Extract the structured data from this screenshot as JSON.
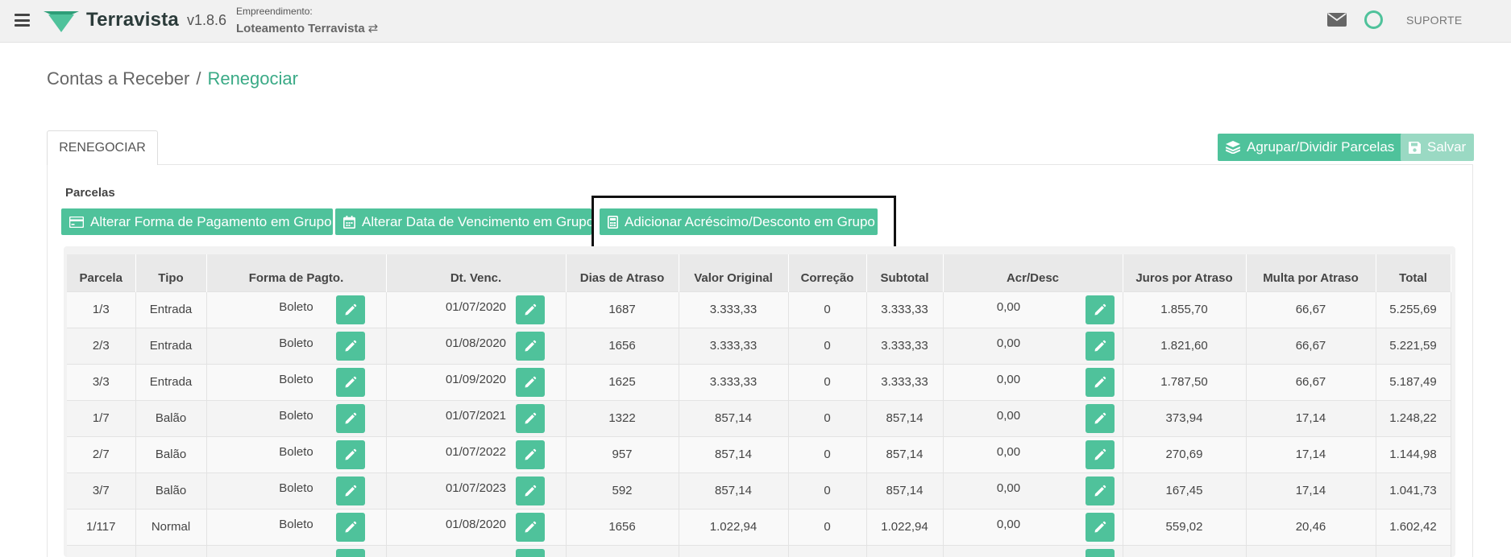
{
  "header": {
    "brand": "Terravista",
    "version": "v1.8.6",
    "empreendimento_label": "Empreendimento:",
    "empreendimento_value": "Loteamento Terravista",
    "swap_glyph": "⇄",
    "support_label": "SUPORTE",
    "brand_color": "#2b3b3a",
    "accent_color": "#4fc29b"
  },
  "breadcrumb": {
    "parent": "Contas a Receber",
    "separator": "/",
    "current": "Renegociar"
  },
  "tab": {
    "label": "RENEGOCIAR"
  },
  "actions": {
    "agrupar_label": "Agrupar/Dividir Parcelas",
    "salvar_label": "Salvar"
  },
  "parcelas": {
    "section_label": "Parcelas",
    "bulk_payment_label": "Alterar Forma de Pagamento em Grupo",
    "bulk_due_date_label": "Alterar Data de Vencimento em Grupo",
    "bulk_add_discount_label": "Adicionar Acréscimo/Desconto em Grupo"
  },
  "table": {
    "columns": [
      "Parcela",
      "Tipo",
      "Forma de Pagto.",
      "Dt. Venc.",
      "Dias de Atraso",
      "Valor Original",
      "Correção",
      "Subtotal",
      "Acr/Desc",
      "Juros por Atraso",
      "Multa por Atraso",
      "Total"
    ],
    "rows": [
      {
        "parcela": "1/3",
        "tipo": "Entrada",
        "forma": "Boleto",
        "venc": "01/07/2020",
        "dias": "1687",
        "valor": "3.333,33",
        "correcao": "0",
        "subtotal": "3.333,33",
        "acr": "0,00",
        "juros": "1.855,70",
        "multa": "66,67",
        "total": "5.255,69"
      },
      {
        "parcela": "2/3",
        "tipo": "Entrada",
        "forma": "Boleto",
        "venc": "01/08/2020",
        "dias": "1656",
        "valor": "3.333,33",
        "correcao": "0",
        "subtotal": "3.333,33",
        "acr": "0,00",
        "juros": "1.821,60",
        "multa": "66,67",
        "total": "5.221,59"
      },
      {
        "parcela": "3/3",
        "tipo": "Entrada",
        "forma": "Boleto",
        "venc": "01/09/2020",
        "dias": "1625",
        "valor": "3.333,33",
        "correcao": "0",
        "subtotal": "3.333,33",
        "acr": "0,00",
        "juros": "1.787,50",
        "multa": "66,67",
        "total": "5.187,49"
      },
      {
        "parcela": "1/7",
        "tipo": "Balão",
        "forma": "Boleto",
        "venc": "01/07/2021",
        "dias": "1322",
        "valor": "857,14",
        "correcao": "0",
        "subtotal": "857,14",
        "acr": "0,00",
        "juros": "373,94",
        "multa": "17,14",
        "total": "1.248,22"
      },
      {
        "parcela": "2/7",
        "tipo": "Balão",
        "forma": "Boleto",
        "venc": "01/07/2022",
        "dias": "957",
        "valor": "857,14",
        "correcao": "0",
        "subtotal": "857,14",
        "acr": "0,00",
        "juros": "270,69",
        "multa": "17,14",
        "total": "1.144,98"
      },
      {
        "parcela": "3/7",
        "tipo": "Balão",
        "forma": "Boleto",
        "venc": "01/07/2023",
        "dias": "592",
        "valor": "857,14",
        "correcao": "0",
        "subtotal": "857,14",
        "acr": "0,00",
        "juros": "167,45",
        "multa": "17,14",
        "total": "1.041,73"
      },
      {
        "parcela": "1/117",
        "tipo": "Normal",
        "forma": "Boleto",
        "venc": "01/08/2020",
        "dias": "1656",
        "valor": "1.022,94",
        "correcao": "0",
        "subtotal": "1.022,94",
        "acr": "0,00",
        "juros": "559,02",
        "multa": "20,46",
        "total": "1.602,42"
      },
      {
        "parcela": "",
        "tipo": "",
        "forma": "",
        "venc": "",
        "dias": "",
        "valor": "",
        "correcao": "",
        "subtotal": "",
        "acr": "",
        "juros": "",
        "multa": "",
        "total": ""
      }
    ]
  }
}
